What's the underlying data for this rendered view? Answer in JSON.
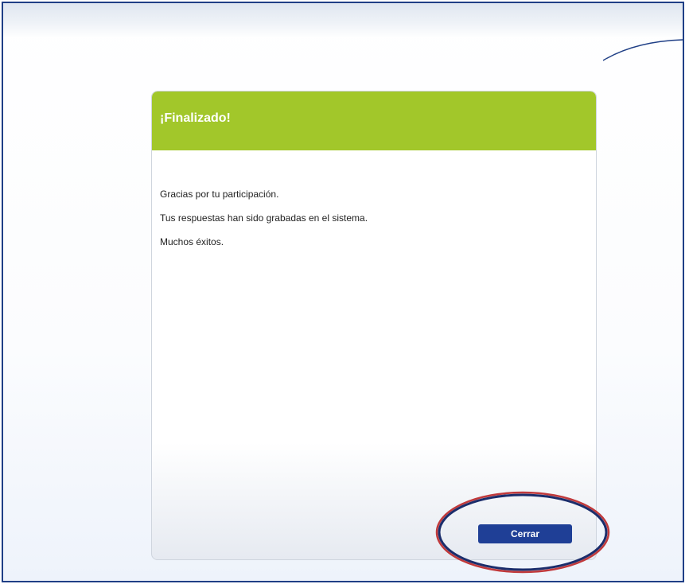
{
  "dialog": {
    "title": "¡Finalizado!",
    "messages": [
      "Gracias por tu participación.",
      "Tus respuestas han sido grabadas en el sistema.",
      "Muchos éxitos."
    ],
    "close_label": "Cerrar"
  },
  "colors": {
    "header": "#a2c72a",
    "button": "#1f3f96",
    "frame": "#1f3f86",
    "highlight_outer": "#c0393b",
    "highlight_inner": "#1b2d6b"
  }
}
